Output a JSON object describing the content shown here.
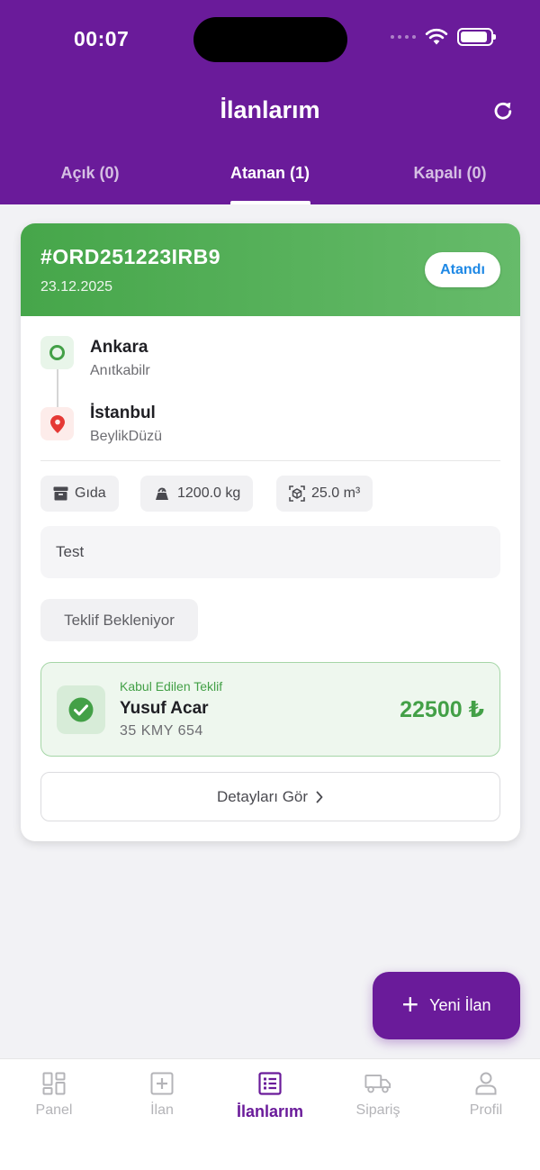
{
  "status_bar": {
    "time": "00:07",
    "battery_level": 0.9
  },
  "header": {
    "title": "İlanlarım",
    "refresh_icon": "refresh-icon"
  },
  "tabs": [
    {
      "label": "Açık (0)",
      "active": false
    },
    {
      "label": "Atanan (1)",
      "active": true
    },
    {
      "label": "Kapalı (0)",
      "active": false
    }
  ],
  "order": {
    "id": "#ORD251223IRB9",
    "date": "23.12.2025",
    "status": "Atandı",
    "origin": {
      "city": "Ankara",
      "district": "Anıtkabilr"
    },
    "destination": {
      "city": "İstanbul",
      "district": "BeylikDüzü"
    },
    "chips": {
      "category": "Gıda",
      "weight": "1200.0 kg",
      "volume": "25.0 m³"
    },
    "note": "Test",
    "offer_status": "Teklif Bekleniyor",
    "accepted_offer": {
      "label": "Kabul Edilen Teklif",
      "driver": "Yusuf Acar",
      "plate": "35 KMY 654",
      "price": "22500 ₺"
    },
    "details_button": "Detayları Gör"
  },
  "fab": {
    "label": "Yeni İlan"
  },
  "bottom_nav": [
    {
      "label": "Panel",
      "icon": "dashboard-icon",
      "active": false
    },
    {
      "label": "İlan",
      "icon": "add-box-icon",
      "active": false
    },
    {
      "label": "İlanlarım",
      "icon": "list-icon",
      "active": true
    },
    {
      "label": "Sipariş",
      "icon": "truck-icon",
      "active": false
    },
    {
      "label": "Profil",
      "icon": "person-icon",
      "active": false
    }
  ],
  "colors": {
    "primary": "#6a1b9a",
    "success": "#43a047",
    "status_pill_text": "#1e88e5",
    "danger": "#e53935"
  }
}
